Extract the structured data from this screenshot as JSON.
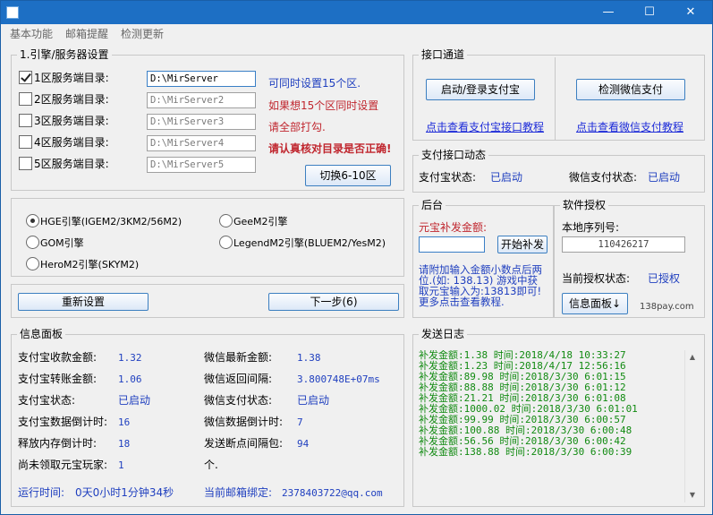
{
  "window": {
    "min": "—",
    "max": "☐",
    "close": "✕"
  },
  "menu": [
    "基本功能",
    "邮箱提醒",
    "检测更新"
  ],
  "engine_group": {
    "title": "1.引擎/服务器设置",
    "servers": [
      {
        "label": "1区服务端目录:",
        "path": "D:\\MirServer",
        "checked": true
      },
      {
        "label": "2区服务端目录:",
        "path": "D:\\MirServer2",
        "checked": false
      },
      {
        "label": "3区服务端目录:",
        "path": "D:\\MirServer3",
        "checked": false
      },
      {
        "label": "4区服务端目录:",
        "path": "D:\\MirServer4",
        "checked": false
      },
      {
        "label": "5区服务端目录:",
        "path": "D:\\MirServer5",
        "checked": false
      }
    ],
    "tips": [
      "可同时设置15个区.",
      "如果想15个区同时设置",
      "请全部打勾.",
      "请认真核对目录是否正确!"
    ],
    "switch_button": "切换6-10区"
  },
  "engine_select": {
    "options": [
      {
        "label": "HGE引擎(IGEM2/3KM2/56M2)",
        "selected": true
      },
      {
        "label": "GeeM2引擎",
        "selected": false
      },
      {
        "label": "GOM引擎",
        "selected": false
      },
      {
        "label": "LegendM2引擎(BLUEM2/YesM2)",
        "selected": false
      },
      {
        "label": "HeroM2引擎(SKYM2)",
        "selected": false
      }
    ]
  },
  "actions": {
    "reset": "重新设置",
    "next": "下一步(6)"
  },
  "channel": {
    "title": "接口通道",
    "alipay_button": "启动/登录支付宝",
    "wechat_button": "检测微信支付",
    "alipay_link": "点击查看支付宝接口教程",
    "wechat_link": "点击查看微信支付教程"
  },
  "status": {
    "title": "支付接口动态",
    "alipay_label": "支付宝状态:",
    "alipay_value": "已启动",
    "wechat_label": "微信支付状态:",
    "wechat_value": "已启动"
  },
  "backend": {
    "title": "后台",
    "amount_label": "元宝补发金额:",
    "amount_value": "",
    "reissue_button": "开始补发",
    "note": [
      "请附加输入金额小数点后两",
      "位.(如: 138.13) 游戏中获",
      "取元宝输入为:13813即可!",
      "更多点击查看教程."
    ]
  },
  "license": {
    "title": "软件授权",
    "serial_label": "本地序列号:",
    "serial_value": "110426217",
    "state_label": "当前授权状态:",
    "state_value": "已授权",
    "panel_button": "信息面板↓",
    "site": "138pay.com"
  },
  "info": {
    "title": "信息面板",
    "left": [
      {
        "label": "支付宝收款金额:",
        "value": "1.32"
      },
      {
        "label": "支付宝转账金额:",
        "value": "1.06"
      },
      {
        "label": "支付宝状态:",
        "value": "已启动"
      },
      {
        "label": "支付宝数据倒计时:",
        "value": "16"
      },
      {
        "label": "释放内存倒计时:",
        "value": "18"
      },
      {
        "label": "尚未领取元宝玩家:",
        "value": "1"
      }
    ],
    "right": [
      {
        "label": "微信最新金额:",
        "value": "1.38"
      },
      {
        "label": "微信返回间隔:",
        "value": "3.800748E+07ms"
      },
      {
        "label": "微信支付状态:",
        "value": "已启动"
      },
      {
        "label": "微信数据倒计时:",
        "value": "7"
      },
      {
        "label": "发送断点间隔包:",
        "value": "94"
      },
      {
        "label": "个.",
        "value": ""
      }
    ],
    "runtime_label": "运行时间:",
    "runtime_value": "0天0小时1分钟34秒",
    "email_label": "当前邮箱绑定:",
    "email_value": "2378403722@qq.com"
  },
  "log": {
    "title": "发送日志",
    "lines": [
      "补发金额:1.38 时间:2018/4/18 10:33:27",
      "补发金额:1.23 时间:2018/4/17 12:56:16",
      "补发金额:89.98 时间:2018/3/30 6:01:15",
      "补发金额:88.88 时间:2018/3/30 6:01:12",
      "补发金额:21.21 时间:2018/3/30 6:01:08",
      "补发金额:1000.02 时间:2018/3/30 6:01:01",
      "补发金额:99.99 时间:2018/3/30 6:00:57",
      "补发金额:100.88 时间:2018/3/30 6:00:48",
      "补发金额:56.56 时间:2018/3/30 6:00:42",
      "补发金额:138.88 时间:2018/3/30 6:00:39"
    ]
  }
}
